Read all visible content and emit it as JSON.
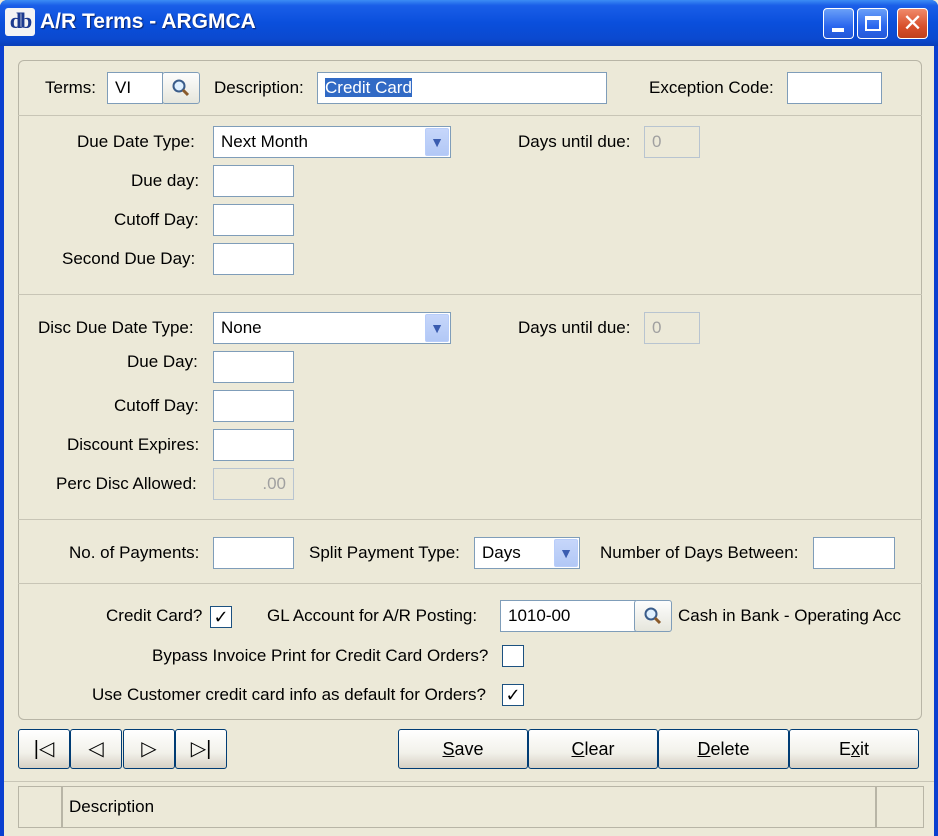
{
  "window": {
    "logo": "db",
    "title": "A/R Terms - ARGMCA"
  },
  "header_row": {
    "terms_label": "Terms:",
    "terms_value": "VI",
    "description_label": "Description:",
    "description_value": "Credit Card",
    "exception_label": "Exception Code:",
    "exception_value": ""
  },
  "due_section": {
    "due_date_type_label": "Due Date Type:",
    "due_date_type_value": "Next Month",
    "days_until_due_label": "Days until due:",
    "days_until_due_value": "0",
    "due_day_label": "Due day:",
    "due_day_value": "",
    "cutoff_day_label": "Cutoff Day:",
    "cutoff_day_value": "",
    "second_due_day_label": "Second Due Day:",
    "second_due_day_value": ""
  },
  "disc_section": {
    "disc_due_date_type_label": "Disc Due Date Type:",
    "disc_due_date_type_value": "None",
    "days_until_due_label": "Days until due:",
    "days_until_due_value": "0",
    "due_day_label": "Due Day:",
    "due_day_value": "",
    "cutoff_day_label": "Cutoff Day:",
    "cutoff_day_value": "",
    "discount_expires_label": "Discount Expires:",
    "discount_expires_value": "",
    "perc_disc_label": "Perc Disc Allowed:",
    "perc_disc_value": ".00"
  },
  "payments": {
    "no_payments_label": "No. of Payments:",
    "no_payments_value": "",
    "split_type_label": "Split Payment Type:",
    "split_type_value": "Days",
    "days_between_label": "Number of Days Between:",
    "days_between_value": ""
  },
  "credit": {
    "credit_card_label": "Credit Card?",
    "credit_card_checked": true,
    "gl_account_label": "GL Account for A/R Posting:",
    "gl_account_value": "1010-00",
    "gl_account_desc": "Cash in Bank - Operating Acc",
    "bypass_label": "Bypass Invoice Print for Credit Card Orders?",
    "bypass_checked": false,
    "use_customer_label": "Use Customer credit card info as default for Orders?",
    "use_customer_checked": true
  },
  "nav": {
    "first": "|◁",
    "prev": "◁",
    "next": "▷",
    "last": "▷|"
  },
  "actions": {
    "save_prefix": "S",
    "save_rest": "ave",
    "clear_prefix": "C",
    "clear_rest": "lear",
    "delete_prefix": "D",
    "delete_rest": "elete",
    "exit_prefix": "E",
    "exit_mid": "x",
    "exit_rest": "it"
  },
  "status": {
    "text": "Description"
  },
  "check_glyph": "✓"
}
